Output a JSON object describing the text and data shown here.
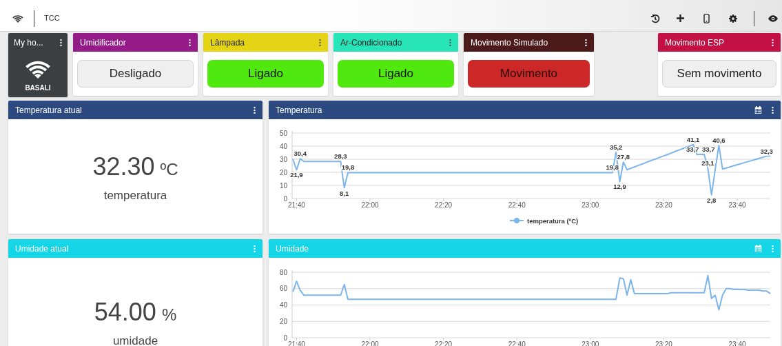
{
  "topbar": {
    "title": "TCC"
  },
  "tiles": [
    {
      "kind": "device",
      "title": "My ho...",
      "label": "BASALI"
    },
    {
      "kind": "switch",
      "title": "Umidificador",
      "color": "#951b89",
      "button": "Desligado",
      "active": false
    },
    {
      "kind": "switch",
      "title": "Lâmpada",
      "color": "#e5d416",
      "button": "Ligado",
      "active": true
    },
    {
      "kind": "switch",
      "title": "Ar-Condicionado",
      "color": "#27e5b8",
      "button": "Ligado",
      "active": true
    },
    {
      "kind": "motion",
      "title": "Movimento Simulado",
      "color": "#4d1a1a",
      "button": "Movimento",
      "active": true
    },
    {
      "kind": "spacer"
    },
    {
      "kind": "motion",
      "title": "Movimento ESP",
      "color": "#c41145",
      "button": "Sem movimento",
      "active": false
    }
  ],
  "rows": [
    {
      "color": "#2d4a80",
      "value_card": {
        "title": "Temperatura atual",
        "value": "32.30",
        "unit": "ºC",
        "caption": "temperatura"
      },
      "chart_card": {
        "title": "Temperatura",
        "chart_data": {
          "type": "line",
          "grid": true,
          "ylim": [
            0,
            50
          ],
          "categories": [
            null,
            "21:40",
            null,
            null,
            null,
            null,
            null,
            null,
            null,
            null,
            null,
            null,
            null,
            null,
            null,
            null,
            null,
            null,
            null,
            null,
            null,
            "22:00",
            null,
            null,
            null,
            null,
            null,
            null,
            null,
            null,
            null,
            null,
            null,
            null,
            null,
            null,
            null,
            null,
            null,
            null,
            null,
            "22:20",
            null,
            null,
            null,
            null,
            null,
            null,
            null,
            null,
            null,
            null,
            null,
            null,
            null,
            null,
            null,
            null,
            null,
            null,
            null,
            "22:40",
            null,
            null,
            null,
            null,
            null,
            null,
            null,
            null,
            null,
            null,
            null,
            null,
            null,
            null,
            null,
            null,
            null,
            null,
            null,
            "23:00",
            null,
            null,
            null,
            null,
            null,
            null,
            null,
            null,
            null,
            null,
            null,
            null,
            null,
            null,
            null,
            null,
            null,
            null,
            null,
            "23:20",
            null,
            null,
            null,
            null,
            null,
            null,
            null,
            null,
            null,
            null,
            null,
            null,
            null,
            null,
            null,
            null,
            null,
            null,
            null,
            "23:40",
            null,
            null,
            null,
            null,
            null,
            null,
            null,
            null,
            null
          ],
          "yticks": [
            0,
            10,
            20,
            30,
            40,
            50
          ],
          "series": [
            {
              "name": "temperatura (ºC)",
              "color": "#7cb5ec",
              "values": [
                30,
                21.9,
                30.4,
                28.3,
                28.3,
                28.3,
                28.3,
                28.3,
                28.3,
                28.3,
                28.3,
                28.3,
                28.3,
                28.3,
                8.1,
                19.8,
                19.8,
                19.8,
                19.8,
                19.8,
                19.8,
                19.8,
                19.8,
                19.8,
                19.8,
                19.8,
                19.8,
                19.8,
                19.8,
                19.8,
                19.8,
                19.8,
                19.8,
                19.8,
                19.8,
                19.8,
                19.8,
                19.8,
                19.8,
                19.8,
                19.8,
                19.8,
                19.8,
                19.8,
                19.8,
                19.8,
                19.8,
                19.8,
                19.8,
                19.8,
                19.8,
                19.8,
                19.8,
                19.8,
                19.8,
                19.8,
                19.8,
                19.8,
                19.8,
                19.8,
                19.8,
                19.8,
                19.8,
                19.8,
                19.8,
                19.8,
                19.8,
                19.8,
                19.8,
                19.8,
                19.8,
                19.8,
                19.8,
                19.8,
                19.8,
                19.8,
                19.8,
                19.8,
                19.8,
                19.8,
                19.8,
                19.8,
                19.8,
                19.8,
                19.8,
                19.8,
                19.8,
                19.8,
                35.2,
                12.9,
                27.8,
                22,
                23.1,
                24.1,
                25.2,
                26.2,
                27.3,
                28.4,
                29.4,
                30.5,
                31.5,
                32.6,
                33.6,
                34.7,
                35.8,
                36.9,
                37.9,
                39,
                40,
                41.1,
                33.7,
                33.7,
                33.7,
                23.1,
                2.8,
                22,
                40.6,
                22.5,
                23.3,
                24.1,
                25,
                25.8,
                26.6,
                27.4,
                28.2,
                29,
                29.9,
                30.7,
                31.5,
                32.3,
                32.5
              ],
              "value_labels": [
                null,
                "21,9",
                "30,4",
                null,
                null,
                null,
                null,
                null,
                null,
                null,
                null,
                null,
                null,
                "28,3",
                "8,1",
                "19,8",
                null,
                null,
                null,
                null,
                null,
                null,
                null,
                null,
                null,
                null,
                null,
                null,
                null,
                null,
                null,
                null,
                null,
                null,
                null,
                null,
                null,
                null,
                null,
                null,
                null,
                null,
                null,
                null,
                null,
                null,
                null,
                null,
                null,
                null,
                null,
                null,
                null,
                null,
                null,
                null,
                null,
                null,
                null,
                null,
                null,
                null,
                null,
                null,
                null,
                null,
                null,
                null,
                null,
                null,
                null,
                null,
                null,
                null,
                null,
                null,
                null,
                null,
                null,
                null,
                null,
                null,
                null,
                null,
                null,
                null,
                null,
                "19,8",
                "35,2",
                "12,9",
                "27,8",
                null,
                null,
                null,
                null,
                null,
                null,
                null,
                null,
                null,
                null,
                null,
                null,
                null,
                null,
                null,
                null,
                null,
                null,
                "41,1",
                "33,7",
                null,
                "33,7",
                "23,1",
                "2,8",
                null,
                "40,6",
                null,
                null,
                null,
                null,
                null,
                null,
                null,
                null,
                null,
                null,
                null,
                null,
                "32,3",
                null
              ]
            }
          ]
        }
      }
    },
    {
      "color": "#15d6e6",
      "value_card": {
        "title": "Umidade atual",
        "value": "54.00",
        "unit": "%",
        "caption": "umidade"
      },
      "chart_card": {
        "title": "Umidade",
        "chart_data": {
          "type": "line",
          "grid": true,
          "ylim": [
            0,
            80
          ],
          "categories": [
            null,
            "21:40",
            null,
            null,
            null,
            null,
            null,
            null,
            null,
            null,
            null,
            null,
            null,
            null,
            null,
            null,
            null,
            null,
            null,
            null,
            null,
            "22:00",
            null,
            null,
            null,
            null,
            null,
            null,
            null,
            null,
            null,
            null,
            null,
            null,
            null,
            null,
            null,
            null,
            null,
            null,
            null,
            "22:20",
            null,
            null,
            null,
            null,
            null,
            null,
            null,
            null,
            null,
            null,
            null,
            null,
            null,
            null,
            null,
            null,
            null,
            null,
            null,
            "22:40",
            null,
            null,
            null,
            null,
            null,
            null,
            null,
            null,
            null,
            null,
            null,
            null,
            null,
            null,
            null,
            null,
            null,
            null,
            null,
            "23:00",
            null,
            null,
            null,
            null,
            null,
            null,
            null,
            null,
            null,
            null,
            null,
            null,
            null,
            null,
            null,
            null,
            null,
            null,
            null,
            "23:20",
            null,
            null,
            null,
            null,
            null,
            null,
            null,
            null,
            null,
            null,
            null,
            null,
            null,
            null,
            null,
            null,
            null,
            null,
            null,
            "23:40",
            null,
            null,
            null,
            null,
            null,
            null,
            null,
            null,
            null
          ],
          "yticks": [
            0,
            20,
            40,
            60,
            80
          ],
          "series": [
            {
              "color": "#7cb5ec",
              "values": [
                56,
                69,
                58,
                52,
                52,
                52,
                52,
                52,
                52,
                52,
                52,
                52,
                52,
                52,
                65,
                47,
                47,
                47,
                47,
                47,
                47,
                47,
                47,
                47,
                47,
                47,
                47,
                47,
                47,
                47,
                47,
                47,
                47,
                47,
                47,
                47,
                47,
                47,
                47,
                47,
                47,
                47,
                47,
                47,
                47,
                47,
                47,
                47,
                47,
                47,
                47,
                47,
                47,
                47,
                47,
                47,
                47,
                47,
                47,
                47,
                47,
                47,
                47,
                47,
                47,
                47,
                47,
                47,
                47,
                47,
                47,
                47,
                47,
                47,
                47,
                47,
                47,
                47,
                47,
                47,
                47,
                47,
                47,
                47,
                47,
                47,
                47,
                47,
                47,
                73,
                72,
                52,
                71,
                54,
                54,
                54,
                54,
                54,
                54,
                54,
                54,
                54,
                54,
                55,
                55,
                55,
                55,
                55,
                55,
                55,
                55,
                55,
                55,
                76,
                48,
                52,
                34,
                52,
                60,
                60,
                59,
                59,
                59,
                59,
                58,
                58,
                58,
                58,
                57,
                57,
                54
              ]
            }
          ]
        }
      }
    }
  ]
}
